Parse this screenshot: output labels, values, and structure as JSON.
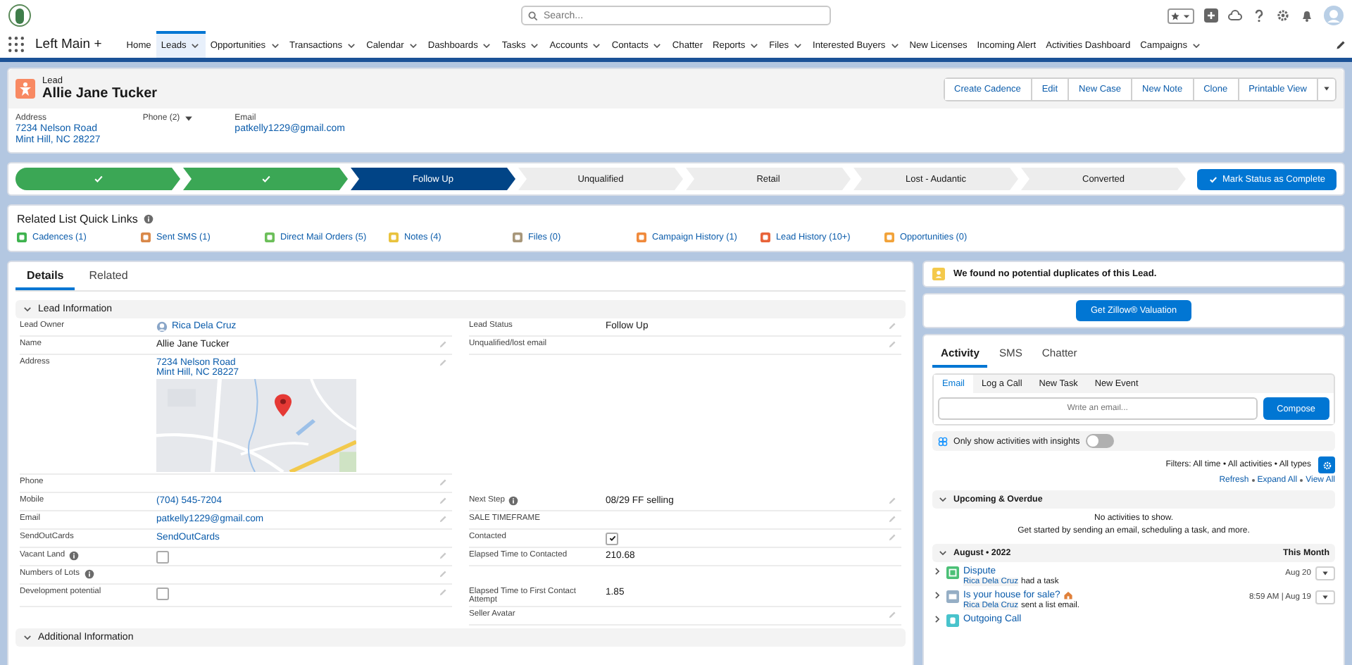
{
  "app": {
    "name": "Left Main +",
    "search": {
      "placeholder": "Search..."
    },
    "nav": [
      {
        "label": "Home",
        "selected": false,
        "dropdown": false
      },
      {
        "label": "Leads",
        "selected": true,
        "dropdown": true
      },
      {
        "label": "Opportunities",
        "selected": false,
        "dropdown": true
      },
      {
        "label": "Transactions",
        "selected": false,
        "dropdown": true
      },
      {
        "label": "Calendar",
        "selected": false,
        "dropdown": true
      },
      {
        "label": "Dashboards",
        "selected": false,
        "dropdown": true
      },
      {
        "label": "Tasks",
        "selected": false,
        "dropdown": true
      },
      {
        "label": "Accounts",
        "selected": false,
        "dropdown": true
      },
      {
        "label": "Contacts",
        "selected": false,
        "dropdown": true
      },
      {
        "label": "Chatter",
        "selected": false,
        "dropdown": false
      },
      {
        "label": "Reports",
        "selected": false,
        "dropdown": true
      },
      {
        "label": "Files",
        "selected": false,
        "dropdown": true
      },
      {
        "label": "Interested Buyers",
        "selected": false,
        "dropdown": true
      },
      {
        "label": "New Licenses",
        "selected": false,
        "dropdown": false
      },
      {
        "label": "Incoming Alert",
        "selected": false,
        "dropdown": false
      },
      {
        "label": "Activities Dashboard",
        "selected": false,
        "dropdown": false
      },
      {
        "label": "Campaigns",
        "selected": false,
        "dropdown": true
      }
    ]
  },
  "record": {
    "object_label": "Lead",
    "name": "Allie Jane Tucker",
    "actions": [
      "Create Cadence",
      "Edit",
      "New Case",
      "New Note",
      "Clone",
      "Printable View"
    ],
    "highlights": [
      {
        "label": "Address",
        "values": [
          "7234 Nelson Road",
          "Mint Hill, NC 28227"
        ],
        "dropdown": false
      },
      {
        "label": "Phone (2)",
        "dropdown": true
      },
      {
        "label": "Email",
        "values": [
          "patkelly1229@gmail.com"
        ],
        "dropdown": false
      }
    ]
  },
  "path": {
    "stages": [
      {
        "complete": true,
        "current": false
      },
      {
        "complete": true,
        "current": false
      },
      {
        "label": "Follow Up",
        "complete": false,
        "current": true
      },
      {
        "label": "Unqualified",
        "complete": false,
        "current": false
      },
      {
        "label": "Retail",
        "complete": false,
        "current": false
      },
      {
        "label": "Lost - Audantic",
        "complete": false,
        "current": false
      },
      {
        "label": "Converted",
        "complete": false,
        "current": false
      }
    ],
    "button": "Mark Status as Complete"
  },
  "quick_links": {
    "title": "Related List Quick Links",
    "links": [
      {
        "label": "Cadences (1)",
        "color": "#3fb34f"
      },
      {
        "label": "Sent SMS (1)",
        "color": "#d9894a"
      },
      {
        "label": "Direct Mail Orders (5)",
        "color": "#6cbf5a"
      },
      {
        "label": "Notes (4)",
        "color": "#e9c33f"
      },
      {
        "label": "Files (0)",
        "color": "#a8977a"
      },
      {
        "label": "Campaign History (1)",
        "color": "#f08a3c"
      },
      {
        "label": "Lead History (10+)",
        "color": "#e8643a"
      },
      {
        "label": "Opportunities (0)",
        "color": "#f2a33a"
      }
    ]
  },
  "details": {
    "tabs": [
      {
        "label": "Details",
        "selected": true
      },
      {
        "label": "Related",
        "selected": false
      }
    ],
    "sections": [
      {
        "title": "Lead Information",
        "expanded": true,
        "rows": [
          {
            "left": {
              "label": "Lead Owner",
              "info": false,
              "kind": "owner",
              "value": "Rica Dela Cruz",
              "editable": false
            },
            "right": {
              "label": "Lead Status",
              "info": false,
              "kind": "text",
              "value": "Follow Up",
              "editable": true
            }
          },
          {
            "left": {
              "label": "Name",
              "info": false,
              "kind": "text",
              "value": "Allie Jane Tucker",
              "editable": true
            },
            "right": {
              "label": "Unqualified/lost email",
              "info": false,
              "kind": "empty",
              "editable": true
            }
          },
          {
            "left": {
              "label": "Address",
              "info": false,
              "kind": "address",
              "values": [
                "7234 Nelson Road",
                "Mint Hill, NC 28227"
              ],
              "editable": true
            }
          },
          {
            "left": {
              "label": "Phone",
              "info": false,
              "kind": "empty",
              "editable": true
            }
          },
          {
            "left": {
              "label": "Mobile",
              "info": false,
              "kind": "link",
              "value": "(704) 545-7204",
              "editable": true
            },
            "right": {
              "label": "Next Step",
              "info": true,
              "kind": "text",
              "value": "08/29 FF selling",
              "editable": true
            }
          },
          {
            "left": {
              "label": "Email",
              "info": false,
              "kind": "link",
              "value": "patkelly1229@gmail.com",
              "editable": true
            },
            "right": {
              "label": "SALE TIMEFRAME",
              "info": false,
              "kind": "empty",
              "editable": true
            }
          },
          {
            "left": {
              "label": "SendOutCards",
              "info": false,
              "kind": "link",
              "value": "SendOutCards",
              "editable": false
            },
            "right": {
              "label": "Contacted",
              "info": false,
              "kind": "checkbox",
              "checked": true,
              "editable": true
            }
          },
          {
            "left": {
              "label": "Vacant Land",
              "info": true,
              "kind": "checkbox",
              "checked": false,
              "editable": true
            },
            "right": {
              "label": "Elapsed Time to Contacted",
              "info": false,
              "kind": "text",
              "value": "210.68",
              "editable": false
            }
          },
          {
            "left": {
              "label": "Numbers of Lots",
              "info": true,
              "kind": "empty",
              "editable": true
            }
          },
          {
            "left": {
              "label": "Development potential",
              "info": false,
              "kind": "checkbox",
              "checked": false,
              "editable": true
            },
            "right": {
              "label": "Elapsed Time to First Contact Attempt",
              "info": false,
              "kind": "text",
              "value": "1.85",
              "editable": false
            }
          },
          {
            "right": {
              "label": "Seller Avatar",
              "info": false,
              "kind": "empty",
              "editable": true
            }
          }
        ]
      },
      {
        "title": "Additional Information",
        "expanded": true
      }
    ]
  },
  "duplicates": {
    "message": "We found no potential duplicates of this Lead."
  },
  "zillow": {
    "button": "Get Zillow® Valuation"
  },
  "activity": {
    "tabs": [
      {
        "label": "Activity",
        "selected": true
      },
      {
        "label": "SMS",
        "selected": false
      },
      {
        "label": "Chatter",
        "selected": false
      }
    ],
    "composer": {
      "tabs": [
        {
          "label": "Email",
          "selected": true
        },
        {
          "label": "Log a Call",
          "selected": false
        },
        {
          "label": "New Task",
          "selected": false
        },
        {
          "label": "New Event",
          "selected": false
        }
      ],
      "placeholder": "Write an email...",
      "button": "Compose"
    },
    "insights_toggle": {
      "label": "Only show activities with insights",
      "on": false
    },
    "filters": "Filters: All time • All activities • All types",
    "links": [
      "Refresh",
      "Expand All",
      "View All"
    ],
    "groups": [
      {
        "title": "Upcoming & Overdue",
        "expanded": true,
        "empty_lines": [
          "No activities to show.",
          "Get started by sending an email, scheduling a task, and more."
        ]
      },
      {
        "title": "August • 2022",
        "expanded": true,
        "badge": "This Month",
        "items": [
          {
            "kind": "task",
            "title": "Dispute",
            "who": "Rica Dela Cruz",
            "action": "had a task",
            "date": "Aug 20",
            "expanded": false,
            "emoji": false
          },
          {
            "kind": "email",
            "title": "Is your house for sale?",
            "emoji": true,
            "who": "Rica Dela Cruz",
            "action": "sent a list email.",
            "date": "8:59 AM | Aug 19",
            "expanded": false
          },
          {
            "kind": "call",
            "title": "Outgoing Call",
            "expanded": false,
            "emoji": false
          }
        ]
      }
    ]
  }
}
